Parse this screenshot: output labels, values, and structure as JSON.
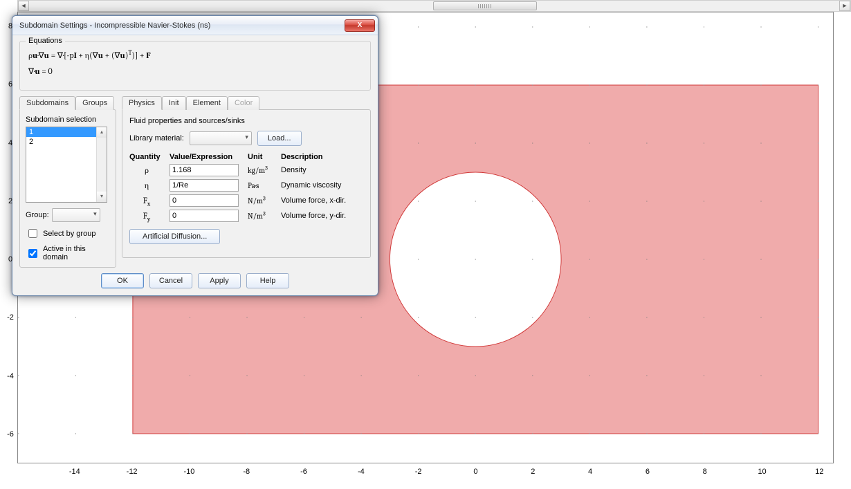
{
  "dialog": {
    "title": "Subdomain Settings - Incompressible Navier-Stokes (ns)",
    "close_glyph": "X",
    "equations_legend": "Equations",
    "eq1_html": "ρ<b>u</b>·∇<b>u</b> = ∇·[-p<b>I</b> + η(∇<b>u</b> + (∇<b>u</b>)<sup>T</sup>)] + <b>F</b>",
    "eq2_html": "∇·<b>u</b> = 0",
    "left_tabs": {
      "subdomains": "Subdomains",
      "groups": "Groups"
    },
    "subsel_label": "Subdomain selection",
    "sub_items": [
      "1",
      "2"
    ],
    "sub_selected_index": 0,
    "group_label": "Group:",
    "select_by_group": "Select by group",
    "select_by_group_checked": false,
    "active_in_domain": "Active in this domain",
    "active_in_domain_checked": true,
    "right_tabs": {
      "physics": "Physics",
      "init": "Init",
      "element": "Element",
      "color": "Color"
    },
    "rt_heading": "Fluid properties and sources/sinks",
    "lib_label": "Library material:",
    "load_btn": "Load...",
    "qhdr": {
      "q": "Quantity",
      "v": "Value/Expression",
      "u": "Unit",
      "d": "Description"
    },
    "rows": [
      {
        "sym_html": "ρ",
        "value": "1.168",
        "unit_html": "kg/m<sup>3</sup>",
        "desc": "Density"
      },
      {
        "sym_html": "η",
        "value": "1/Re",
        "unit_html": "Pa·s",
        "desc": "Dynamic viscosity"
      },
      {
        "sym_html": "F<span class=sub>x</span>",
        "value": "0",
        "unit_html": "N/m<sup>3</sup>",
        "desc": "Volume force, x-dir."
      },
      {
        "sym_html": "F<span class=sub>y</span>",
        "value": "0",
        "unit_html": "N/m<sup>3</sup>",
        "desc": "Volume force, y-dir."
      }
    ],
    "artdiff_btn": "Artificial Diffusion...",
    "buttons": {
      "ok": "OK",
      "cancel": "Cancel",
      "apply": "Apply",
      "help": "Help"
    }
  },
  "chart_data": {
    "type": "area",
    "title": "",
    "xlabel": "",
    "ylabel": "",
    "xlim": [
      -16,
      12.5
    ],
    "ylim": [
      -7,
      8.5
    ],
    "x_ticks": [
      -14,
      -12,
      -10,
      -8,
      -6,
      -4,
      -2,
      0,
      2,
      4,
      6,
      8,
      10,
      12
    ],
    "y_ticks": [
      -6,
      -4,
      -2,
      0,
      2,
      4,
      6,
      8
    ],
    "domain_rect": {
      "x1": -12,
      "y1": -6,
      "x2": 12,
      "y2": 6,
      "fill": "#f0abab",
      "stroke": "#d13a3a"
    },
    "cutout_circle": {
      "cx": 0,
      "cy": 0,
      "r": 3,
      "fill": "#ffffff",
      "stroke": "#d13a3a"
    },
    "grid_dots": {
      "dx": 2,
      "dy": 2,
      "color": "#7b7b7b"
    }
  }
}
